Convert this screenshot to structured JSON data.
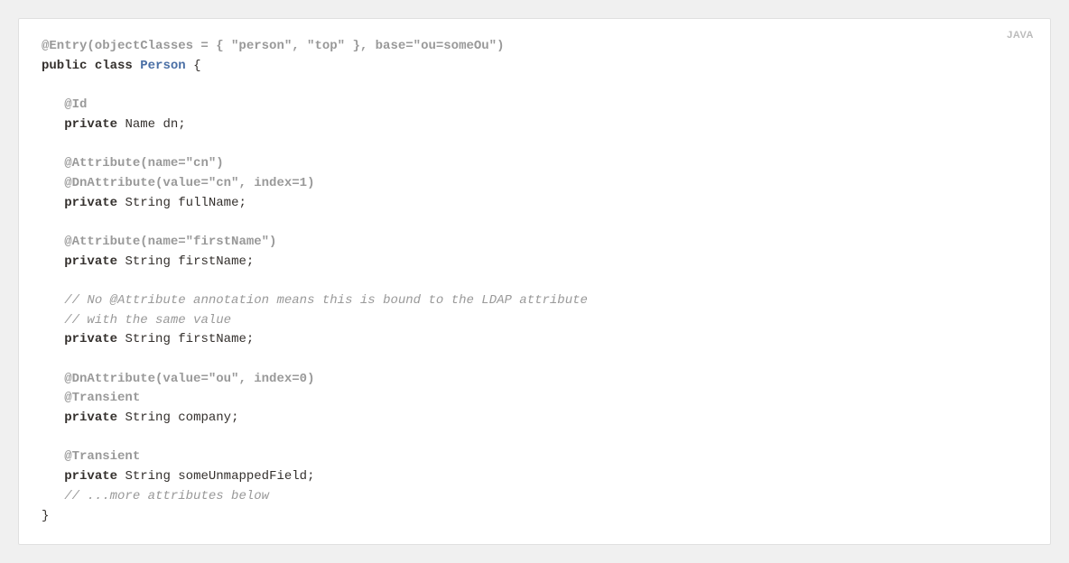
{
  "lang_label": "JAVA",
  "code": {
    "annot_entry": "@Entry(objectClasses = { \"person\", \"top\" }, base=\"ou=someOu\")",
    "kw_public": "public",
    "kw_class": "class",
    "classname": "Person",
    "brace_open": " {",
    "annot_id": "@Id",
    "kw_private": "private",
    "type_name": "Name",
    "field_dn": " dn;",
    "annot_attr_cn": "@Attribute(name=\"cn\")",
    "annot_dnattr_cn": "@DnAttribute(value=\"cn\", index=1)",
    "type_string": "String",
    "field_fullname": " fullName;",
    "annot_attr_firstname": "@Attribute(name=\"firstName\")",
    "field_firstname": " firstName;",
    "comment1": "// No @Attribute annotation means this is bound to the LDAP attribute",
    "comment2": "// with the same value",
    "field_firstname2": " firstName;",
    "annot_dnattr_ou": "@DnAttribute(value=\"ou\", index=0)",
    "annot_transient": "@Transient",
    "field_company": " company;",
    "field_unmapped": " someUnmappedField;",
    "comment3": "// ...more attributes below",
    "brace_close": "}"
  }
}
